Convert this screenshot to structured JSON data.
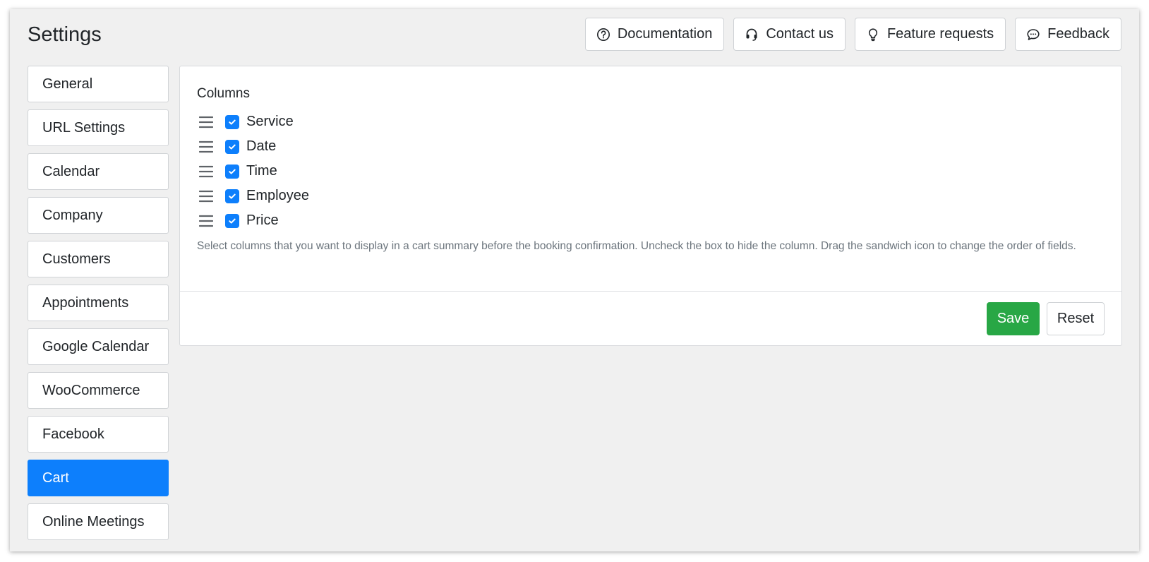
{
  "header": {
    "title": "Settings",
    "actions": [
      {
        "label": "Documentation",
        "icon": "question-circle-icon"
      },
      {
        "label": "Contact us",
        "icon": "headset-icon"
      },
      {
        "label": "Feature requests",
        "icon": "lightbulb-icon"
      },
      {
        "label": "Feedback",
        "icon": "chat-icon"
      }
    ]
  },
  "sidebar": {
    "items": [
      {
        "label": "General",
        "active": false
      },
      {
        "label": "URL Settings",
        "active": false
      },
      {
        "label": "Calendar",
        "active": false
      },
      {
        "label": "Company",
        "active": false
      },
      {
        "label": "Customers",
        "active": false
      },
      {
        "label": "Appointments",
        "active": false
      },
      {
        "label": "Google Calendar",
        "active": false
      },
      {
        "label": "WooCommerce",
        "active": false
      },
      {
        "label": "Facebook",
        "active": false
      },
      {
        "label": "Cart",
        "active": true
      },
      {
        "label": "Online Meetings",
        "active": false
      }
    ]
  },
  "main": {
    "section_label": "Columns",
    "columns": [
      {
        "label": "Service",
        "checked": true
      },
      {
        "label": "Date",
        "checked": true
      },
      {
        "label": "Time",
        "checked": true
      },
      {
        "label": "Employee",
        "checked": true
      },
      {
        "label": "Price",
        "checked": true
      }
    ],
    "help_text": "Select columns that you want to display in a cart summary before the booking confirmation. Uncheck the box to hide the column. Drag the sandwich icon to change the order of fields.",
    "save_label": "Save",
    "reset_label": "Reset"
  },
  "colors": {
    "accent": "#0d7ffc",
    "success": "#28a745",
    "background": "#f0f0f0"
  }
}
